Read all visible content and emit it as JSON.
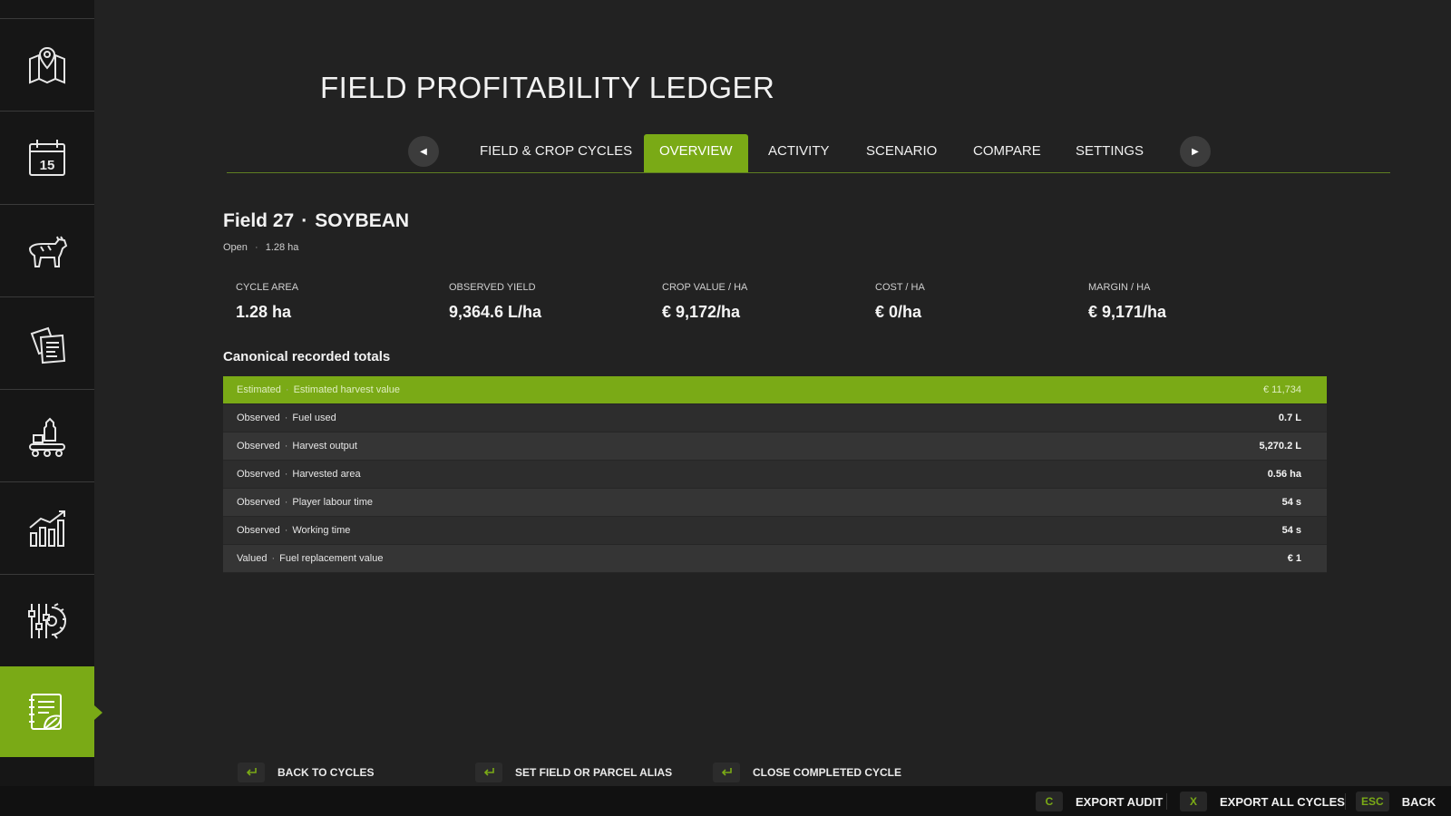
{
  "colors": {
    "accent": "#7aaa16",
    "background": "#222222",
    "sidebar": "#161616"
  },
  "sidebar": {
    "items": [
      {
        "icon": "map-pin-icon",
        "active": false
      },
      {
        "icon": "calendar-icon",
        "day": "15",
        "active": false
      },
      {
        "icon": "cow-icon",
        "active": false
      },
      {
        "icon": "documents-icon",
        "active": false
      },
      {
        "icon": "production-icon",
        "active": false
      },
      {
        "icon": "bar-chart-icon",
        "active": false
      },
      {
        "icon": "settings-gear-icon",
        "active": false
      },
      {
        "icon": "ledger-notebook-icon",
        "active": true
      }
    ]
  },
  "header": {
    "title": "FIELD PROFITABILITY LEDGER"
  },
  "tabs": [
    {
      "label": "FIELD & CROP CYCLES",
      "active": false
    },
    {
      "label": "OVERVIEW",
      "active": true
    },
    {
      "label": "ACTIVITY",
      "active": false
    },
    {
      "label": "SCENARIO",
      "active": false
    },
    {
      "label": "COMPARE",
      "active": false
    },
    {
      "label": "SETTINGS",
      "active": false
    }
  ],
  "field": {
    "name": "Field 27",
    "separator": "·",
    "crop": "SOYBEAN",
    "status": "Open",
    "area": "1.28 ha"
  },
  "stats": [
    {
      "label": "CYCLE AREA",
      "value": "1.28 ha"
    },
    {
      "label": "OBSERVED YIELD",
      "value": "9,364.6 L/ha"
    },
    {
      "label": "CROP VALUE / HA",
      "value": "€ 9,172/ha"
    },
    {
      "label": "COST / HA",
      "value": "€ 0/ha"
    },
    {
      "label": "MARGIN / HA",
      "value": "€ 9,171/ha"
    }
  ],
  "ledger": {
    "title": "Canonical recorded totals",
    "rows": [
      {
        "kind": "Estimated",
        "label": "Estimated harvest value",
        "amount": "€ 11,734",
        "highlight": true
      },
      {
        "kind": "Observed",
        "label": "Fuel used",
        "amount": "0.7 L",
        "highlight": false
      },
      {
        "kind": "Observed",
        "label": "Harvest output",
        "amount": "5,270.2 L",
        "highlight": false
      },
      {
        "kind": "Observed",
        "label": "Harvested area",
        "amount": "0.56 ha",
        "highlight": false
      },
      {
        "kind": "Observed",
        "label": "Player labour time",
        "amount": "54 s",
        "highlight": false
      },
      {
        "kind": "Observed",
        "label": "Working time",
        "amount": "54 s",
        "highlight": false
      },
      {
        "kind": "Valued",
        "label": "Fuel replacement value",
        "amount": "€ 1",
        "highlight": false
      }
    ]
  },
  "actions": [
    {
      "label": "BACK TO CYCLES",
      "icon": "enter-key-icon"
    },
    {
      "label": "SET FIELD OR PARCEL ALIAS",
      "icon": "enter-key-icon"
    },
    {
      "label": "CLOSE COMPLETED CYCLE",
      "icon": "enter-key-icon"
    }
  ],
  "footer": [
    {
      "key": "C",
      "label": "EXPORT AUDIT"
    },
    {
      "key": "X",
      "label": "EXPORT ALL CYCLES"
    },
    {
      "key": "ESC",
      "label": "BACK"
    }
  ]
}
